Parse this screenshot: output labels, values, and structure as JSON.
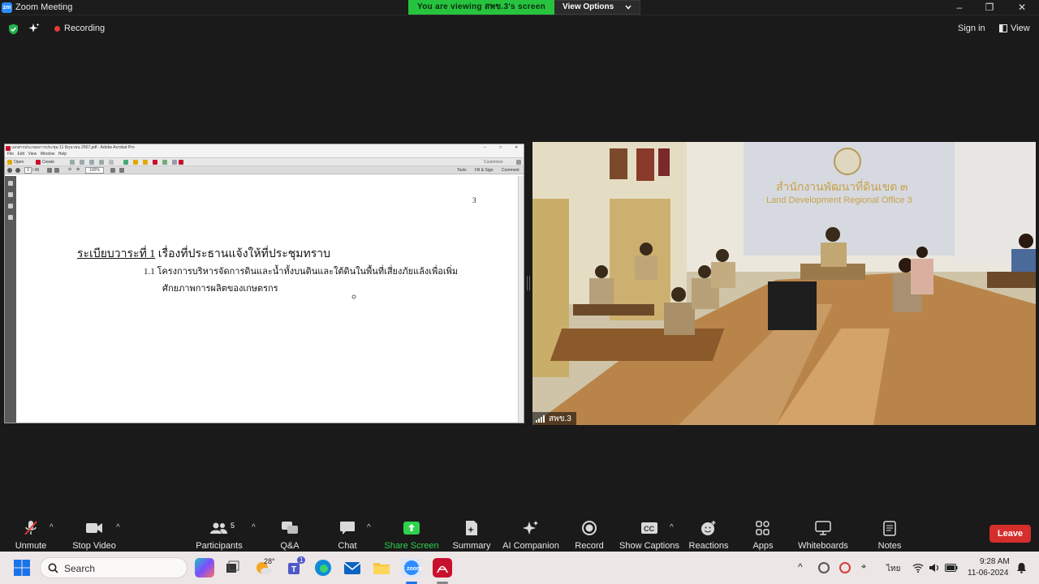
{
  "window": {
    "logo": "zm",
    "title": "Zoom Meeting",
    "minimize_icon": "–",
    "restore_icon": "❐",
    "close_icon": "✕"
  },
  "share_banner": {
    "viewing": "You are viewing สพข.3's screen",
    "view_options": "View Options"
  },
  "meeting_bar": {
    "recording": "Recording",
    "sign_in": "Sign in",
    "view": "View"
  },
  "acrobat": {
    "title": "เอกสารประกอบการประชุม 11 มิถุนายน 2567.pdf - Adobe Acrobat Pro",
    "menu": "File Edit View Window Help",
    "open": "Open",
    "create": "Create",
    "customize": "Customize",
    "page_input": "3",
    "page_total": "/ 45",
    "zoom": "100%",
    "tools": "Tools",
    "fill_sign": "Fill & Sign",
    "comment": "Comment",
    "doc": {
      "page_number": "3",
      "heading_underlined": "ระเบียบวาระที่ 1",
      "heading_rest": " เรื่องที่ประธานแจ้งให้ที่ประชุมทราบ",
      "line1": "1.1 โครงการบริหารจัดการดินและน้ำทั้งบนดินและใต้ดินในพื้นที่เสี่ยงภัยแล้งเพื่อเพิ่ม",
      "line2": "ศักยภาพการผลิตของเกษตรกร"
    }
  },
  "video": {
    "participant_name": "สพข.3",
    "sign_thai": "สำนักงานพัฒนาที่ดินเขต ๓",
    "sign_english": "Land Development Regional Office 3"
  },
  "toolbar": {
    "unmute": "Unmute",
    "stop_video": "Stop Video",
    "participants": "Participants",
    "participants_count": "5",
    "qa": "Q&A",
    "chat": "Chat",
    "share_screen": "Share Screen",
    "summary": "Summary",
    "ai_companion": "AI Companion",
    "record": "Record",
    "show_captions": "Show Captions",
    "reactions": "Reactions",
    "apps": "Apps",
    "whiteboards": "Whiteboards",
    "notes": "Notes",
    "leave": "Leave"
  },
  "taskbar": {
    "search_placeholder": "Search",
    "weather": "28°",
    "teams_badge": "1",
    "language": "ไทย",
    "time": "9:28 AM",
    "date": "11-06-2024"
  },
  "colors": {
    "share_green": "#27c33f",
    "leave_red": "#d62d2d",
    "zoom_blue": "#2d8cff"
  }
}
